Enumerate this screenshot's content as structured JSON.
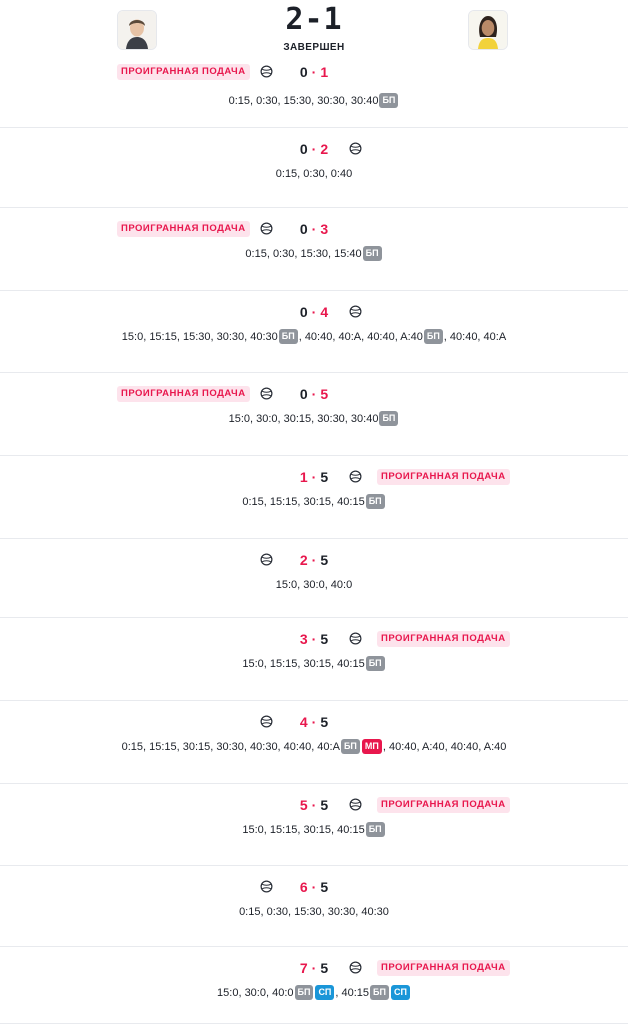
{
  "header": {
    "score": "2-1",
    "status": "ЗАВЕРШЕН",
    "player1_avatar": "player-1-photo",
    "player2_avatar": "player-2-photo"
  },
  "labels": {
    "lost_serve": "ПРОИГРАННАЯ ПОДАЧА"
  },
  "colors": {
    "accent": "#e8174d",
    "bp": "#8f949b",
    "sp": "#1a96d8",
    "mp": "#e8174d",
    "lost_bg": "#fde3ec"
  },
  "icons": {
    "serve": "tennis-ball-icon"
  },
  "games": [
    {
      "left": "0",
      "right": "1",
      "red": "right",
      "server": "left",
      "lost": "left",
      "points": [
        {
          "t": "0:15, 0:30, 15:30, 30:30, 30:40"
        },
        {
          "tag": "bp",
          "label": "БП"
        }
      ]
    },
    {
      "left": "0",
      "right": "2",
      "red": "right",
      "server": "right",
      "lost": null,
      "points": [
        {
          "t": "0:15, 0:30, 0:40"
        }
      ]
    },
    {
      "left": "0",
      "right": "3",
      "red": "right",
      "server": "left",
      "lost": "left",
      "points": [
        {
          "t": "0:15, 0:30, 15:30, 15:40"
        },
        {
          "tag": "bp",
          "label": "БП"
        }
      ]
    },
    {
      "left": "0",
      "right": "4",
      "red": "right",
      "server": "right",
      "lost": null,
      "points": [
        {
          "t": "15:0, 15:15, 15:30, 30:30, 40:30"
        },
        {
          "tag": "bp",
          "label": "БП"
        },
        {
          "t": ", 40:40, 40:A, 40:40, A:40"
        },
        {
          "tag": "bp",
          "label": "БП"
        },
        {
          "t": ", 40:40, 40:A"
        }
      ]
    },
    {
      "left": "0",
      "right": "5",
      "red": "right",
      "server": "left",
      "lost": "left",
      "points": [
        {
          "t": "15:0, 30:0, 30:15, 30:30, 30:40"
        },
        {
          "tag": "bp",
          "label": "БП"
        }
      ]
    },
    {
      "left": "1",
      "right": "5",
      "red": "left",
      "server": "right",
      "lost": "right",
      "points": [
        {
          "t": "0:15, 15:15, 30:15, 40:15"
        },
        {
          "tag": "bp",
          "label": "БП"
        }
      ]
    },
    {
      "left": "2",
      "right": "5",
      "red": "left",
      "server": "left",
      "lost": null,
      "points": [
        {
          "t": "15:0, 30:0, 40:0"
        }
      ]
    },
    {
      "left": "3",
      "right": "5",
      "red": "left",
      "server": "right",
      "lost": "right",
      "points": [
        {
          "t": "15:0, 15:15, 30:15, 40:15"
        },
        {
          "tag": "bp",
          "label": "БП"
        }
      ]
    },
    {
      "left": "4",
      "right": "5",
      "red": "left",
      "server": "left",
      "lost": null,
      "points": [
        {
          "t": "0:15, 15:15, 30:15, 30:30, 40:30, 40:40, 40:A"
        },
        {
          "tag": "bp",
          "label": "БП"
        },
        {
          "tag": "mp",
          "label": "МП"
        },
        {
          "t": ", 40:40, A:40, 40:40, A:40"
        }
      ]
    },
    {
      "left": "5",
      "right": "5",
      "red": "left",
      "server": "right",
      "lost": "right",
      "points": [
        {
          "t": "15:0, 15:15, 30:15, 40:15"
        },
        {
          "tag": "bp",
          "label": "БП"
        }
      ]
    },
    {
      "left": "6",
      "right": "5",
      "red": "left",
      "server": "left",
      "lost": null,
      "points": [
        {
          "t": "0:15, 0:30, 15:30, 30:30, 40:30"
        }
      ]
    },
    {
      "left": "7",
      "right": "5",
      "red": "left",
      "server": "right",
      "lost": "right",
      "points": [
        {
          "t": "15:0, 30:0, 40:0"
        },
        {
          "tag": "bp",
          "label": "БП"
        },
        {
          "tag": "sp",
          "label": "СП"
        },
        {
          "t": ", 40:15"
        },
        {
          "tag": "bp",
          "label": "БП"
        },
        {
          "tag": "sp",
          "label": "СП"
        }
      ]
    }
  ]
}
